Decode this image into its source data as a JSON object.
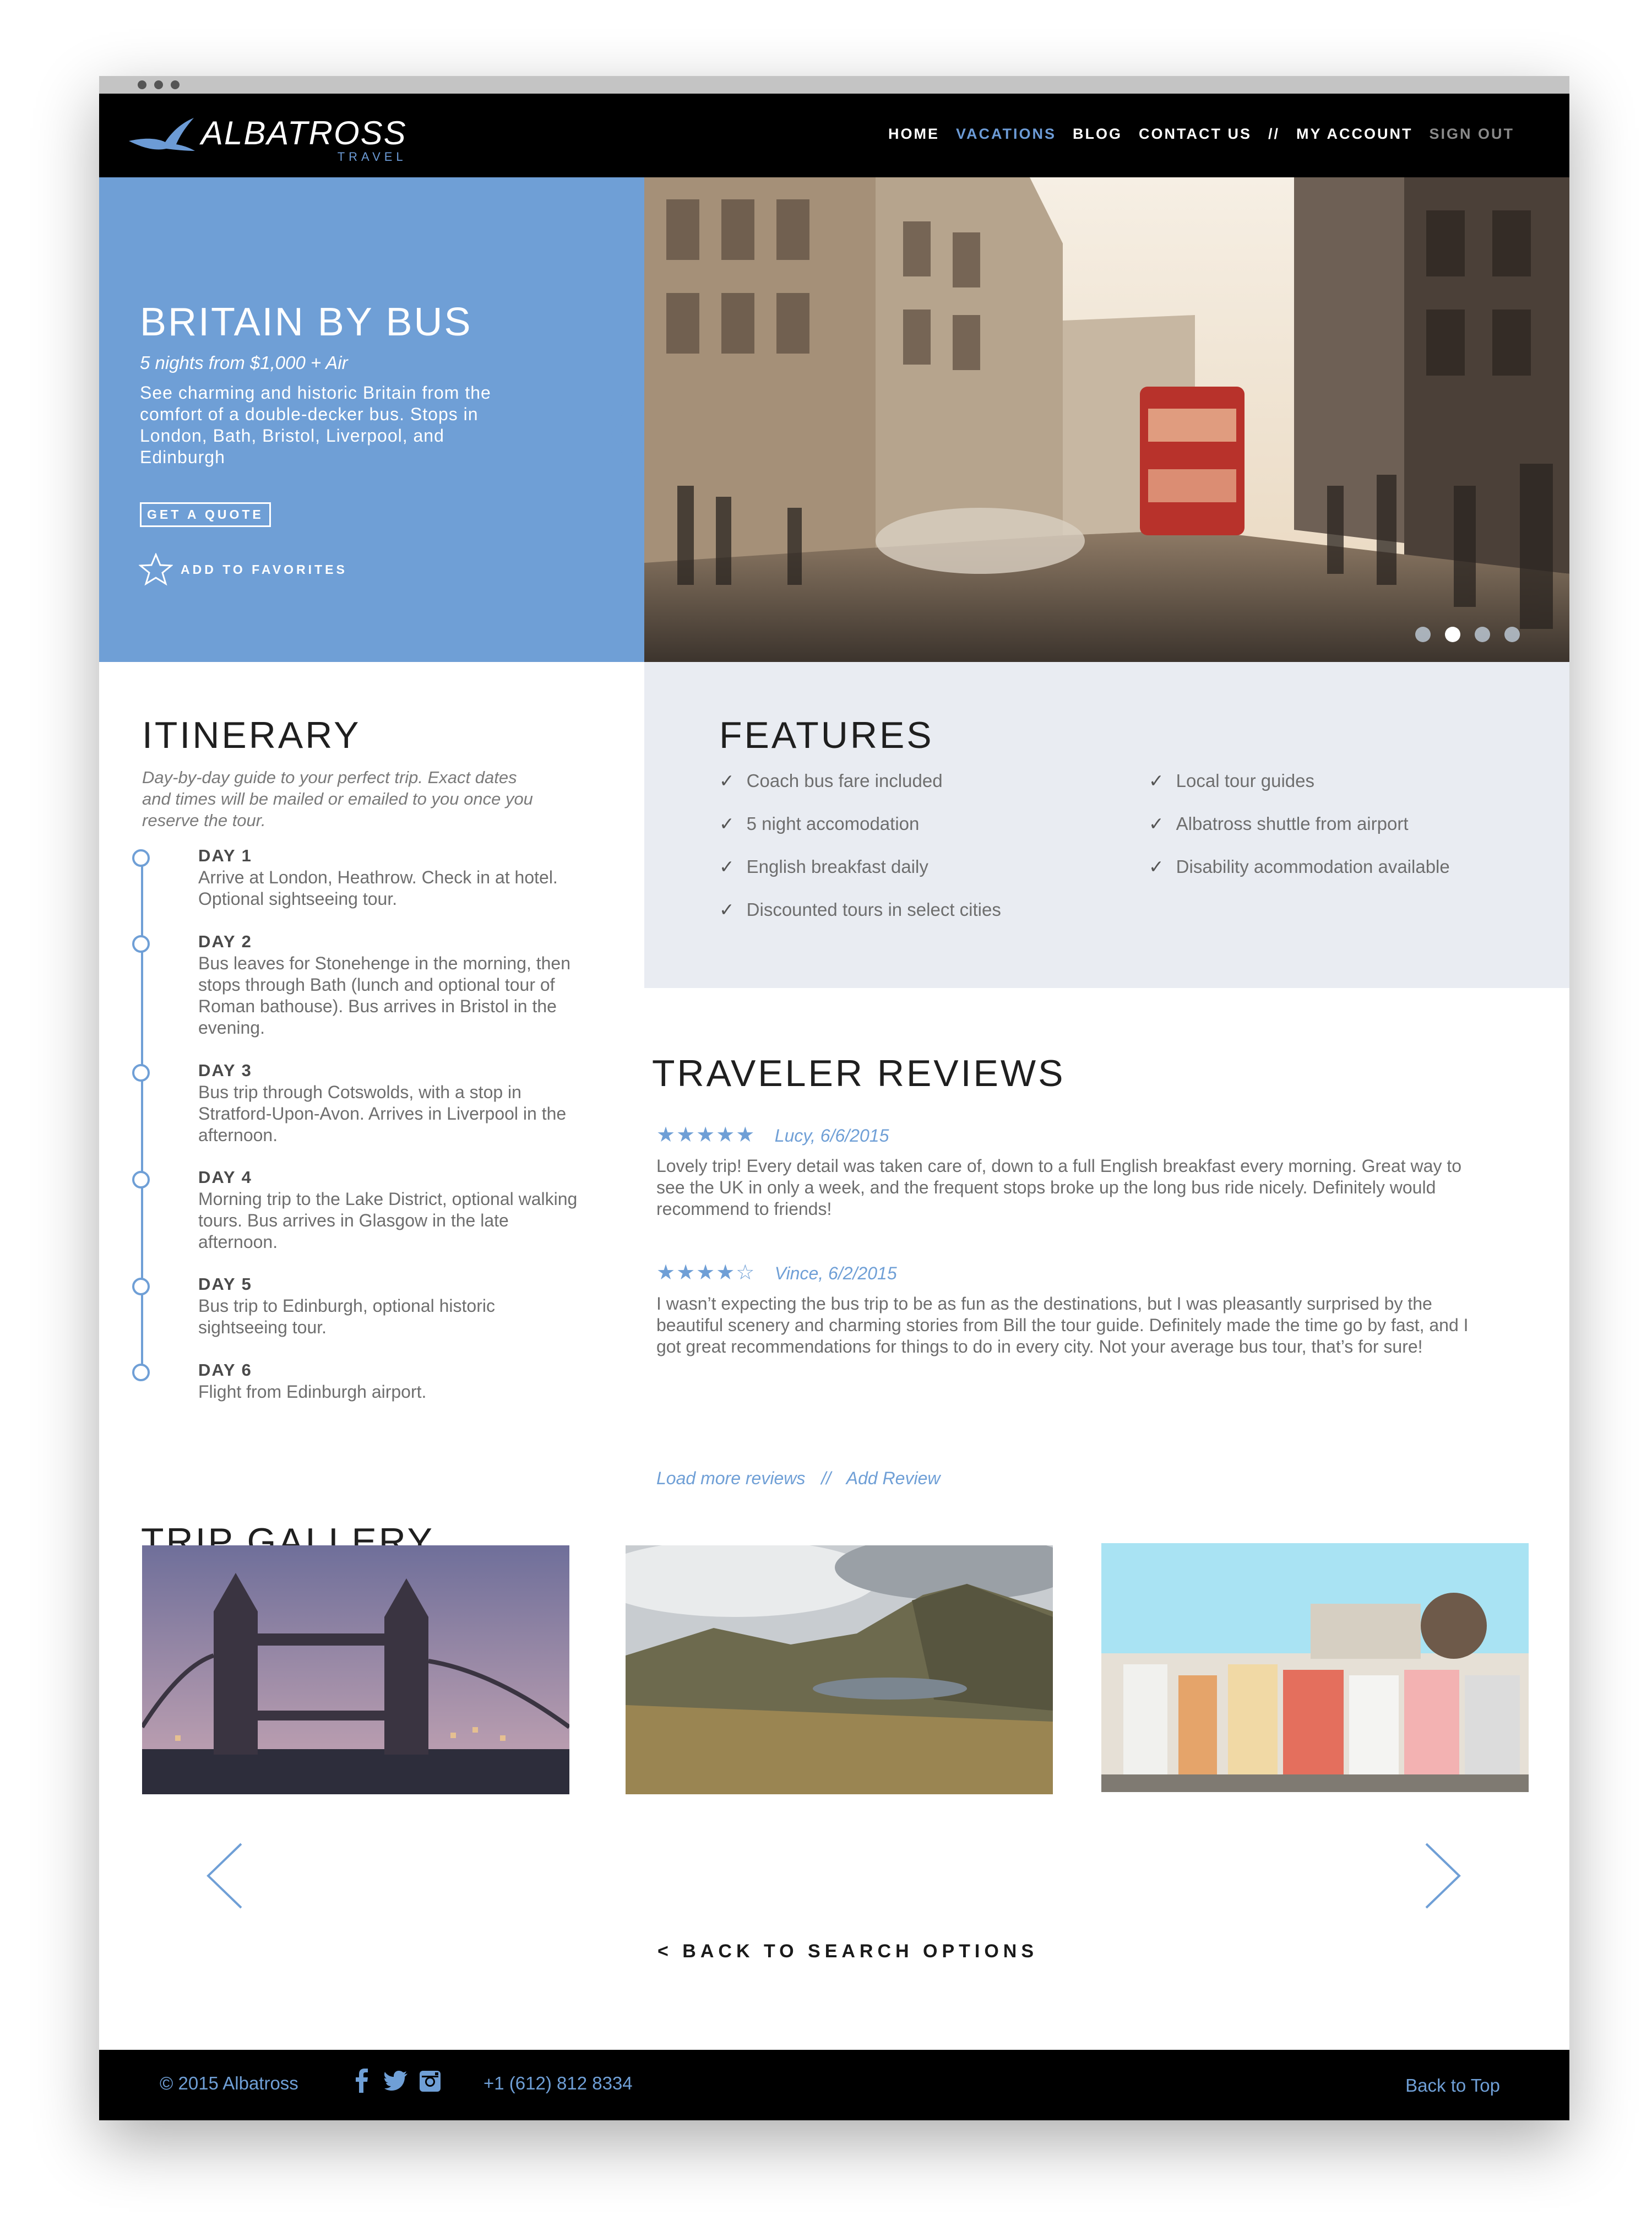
{
  "brand": {
    "name": "ALBATROSS",
    "tagline": "TRAVEL"
  },
  "nav": {
    "items": [
      {
        "label": "HOME",
        "state": "normal"
      },
      {
        "label": "VACATIONS",
        "state": "active"
      },
      {
        "label": "BLOG",
        "state": "normal"
      },
      {
        "label": "CONTACT US",
        "state": "normal"
      },
      {
        "label": "//",
        "state": "normal"
      },
      {
        "label": "MY ACCOUNT",
        "state": "normal"
      },
      {
        "label": "SIGN OUT",
        "state": "muted"
      }
    ]
  },
  "hero": {
    "title": "BRITAIN BY BUS",
    "price": "5 nights from $1,000 + Air",
    "description": "See charming and historic Britain from the comfort of a double-decker bus. Stops in London, Bath, Bristol, Liverpool, and Edinburgh",
    "quote_button": "GET A QUOTE",
    "favorite_label": "ADD TO FAVORITES",
    "slides": 4,
    "active_slide": 2
  },
  "itinerary": {
    "title": "ITINERARY",
    "intro": "Day-by-day guide to your perfect trip. Exact dates and times will be mailed or emailed to you once you reserve the tour.",
    "days": [
      {
        "label": "DAY 1",
        "text": "Arrive at London, Heathrow. Check in at hotel. Optional sightseeing tour."
      },
      {
        "label": "DAY 2",
        "text": "Bus leaves for Stonehenge in the morning, then stops through Bath (lunch and optional tour of Roman bathouse). Bus arrives in Bristol in the evening."
      },
      {
        "label": "DAY 3",
        "text": "Bus trip through Cotswolds, with a stop in Stratford-Upon-Avon. Arrives in Liverpool in the afternoon."
      },
      {
        "label": "DAY 4",
        "text": "Morning trip to the Lake District, optional walking tours. Bus arrives in Glasgow in the late afternoon."
      },
      {
        "label": "DAY 5",
        "text": "Bus trip to Edinburgh, optional historic sightseeing tour."
      },
      {
        "label": "DAY 6",
        "text": "Flight from Edinburgh airport."
      }
    ]
  },
  "features": {
    "title": "FEATURES",
    "check": "✓",
    "left": [
      "Coach bus fare included",
      "5 night accomodation",
      "English breakfast daily",
      "Discounted tours in select cities"
    ],
    "right": [
      "Local tour guides",
      "Albatross shuttle from airport",
      "Disability acommodation available"
    ]
  },
  "reviews": {
    "title": "TRAVELER REVIEWS",
    "items": [
      {
        "stars": "★★★★★",
        "rating": 5,
        "author": "Lucy, 6/6/2015",
        "text": "Lovely trip! Every detail was taken care of, down to a full English breakfast every morning. Great way to see the UK in only a week, and the frequent stops broke up the long bus ride nicely. Definitely would recommend to friends!"
      },
      {
        "stars": "★★★★☆",
        "rating": 4,
        "author": "Vince, 6/2/2015",
        "text": "I wasn’t expecting the bus trip to be as fun as the destinations, but I was pleasantly surprised by the beautiful scenery and charming stories from Bill the tour guide. Definitely made the time go by fast, and I got great recommendations for things to do in every city. Not your average bus tour, that’s for sure!"
      }
    ],
    "load_more": "Load more reviews",
    "separator": "//",
    "add_review": "Add Review"
  },
  "gallery": {
    "title": "TRIP GALLERY"
  },
  "back_to_search": "< BACK TO SEARCH OPTIONS",
  "footer": {
    "copyright": "© 2015 Albatross",
    "phone": "+1 (612) 812 8334",
    "back_to_top": "Back to Top"
  },
  "colors": {
    "accent": "#6f9fd6",
    "nav_bg": "#000000",
    "features_bg": "#e9ecf2"
  }
}
